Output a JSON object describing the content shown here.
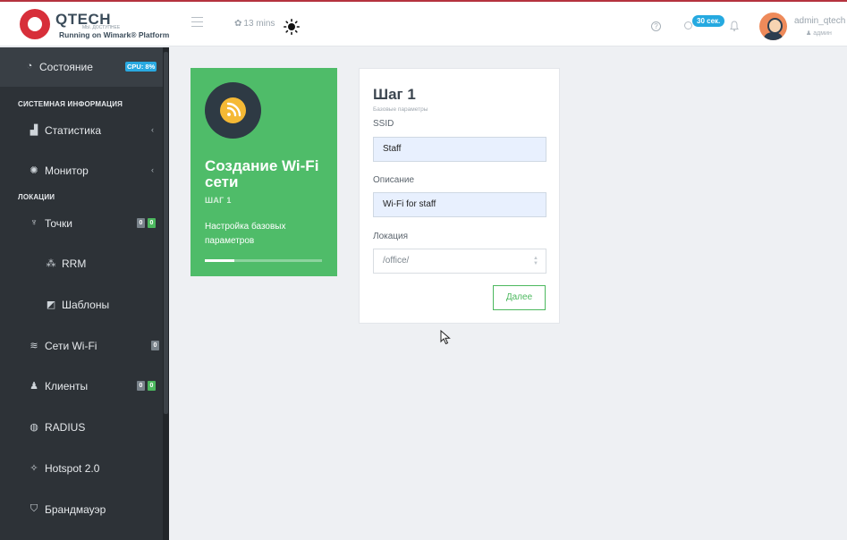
{
  "header": {
    "logo_name": "QTECH",
    "logo_sub": "МЫ. ДОСТУПНЕЕ",
    "logo_tagline": "Running on Wimark® Platform",
    "refresh_label": "13 mins",
    "timer_badge": "30 сек.",
    "user_name": "admin_qtech",
    "user_role": "админ"
  },
  "sidebar": {
    "status": {
      "label": "Состояние",
      "cpu_badge": "CPU: 8%"
    },
    "section_system": "СИСТЕМНАЯ ИНФОРМАЦИЯ",
    "statistics": {
      "label": "Статистика"
    },
    "monitor": {
      "label": "Монитор"
    },
    "section_locations": "ЛОКАЦИИ",
    "points": {
      "label": "Точки",
      "count_a": "0",
      "count_b": "0"
    },
    "rrm": {
      "label": "RRM"
    },
    "templates": {
      "label": "Шаблоны"
    },
    "wifi_networks": {
      "label": "Сети Wi-Fi",
      "count": "0"
    },
    "clients": {
      "label": "Клиенты",
      "count_a": "0",
      "count_b": "0"
    },
    "radius": {
      "label": "RADIUS"
    },
    "hotspot": {
      "label": "Hotspot 2.0"
    },
    "firewall": {
      "label": "Брандмауэр"
    }
  },
  "wizard_card": {
    "title": "Создание Wi-Fi сети",
    "step": "ШАГ 1",
    "description": "Настройка базовых параметров",
    "progress": 0.25
  },
  "form": {
    "step_title": "Шаг 1",
    "step_subtitle": "Базовые параметры",
    "ssid_label": "SSID",
    "ssid_value": "Staff",
    "description_label": "Описание",
    "description_value": "Wi-Fi for staff",
    "location_label": "Локация",
    "location_value": "/office/",
    "next_button": "Далее"
  },
  "colors": {
    "accent_green": "#4fbc69",
    "sidebar_bg": "#2d3237",
    "badge_blue": "#29a9e1",
    "brand_red": "#d72f3a"
  }
}
